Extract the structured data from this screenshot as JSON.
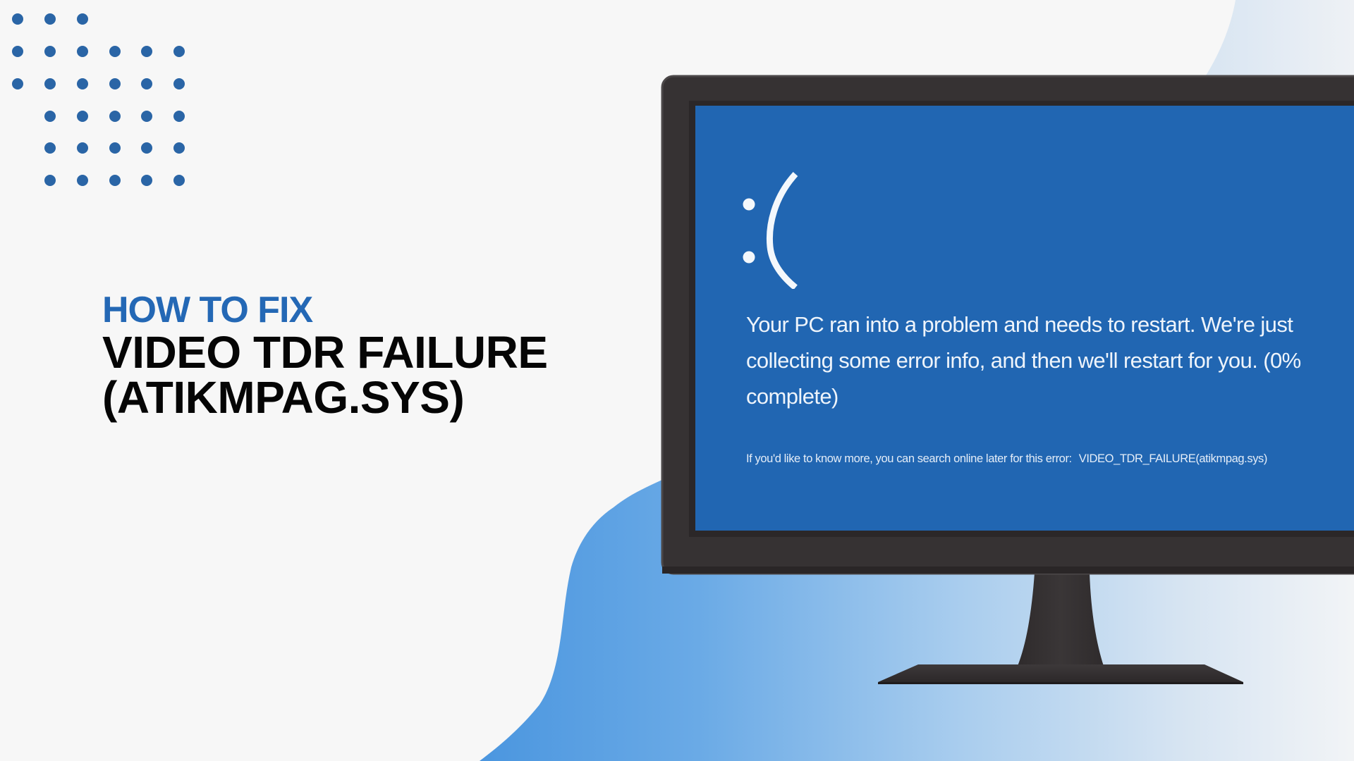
{
  "colors": {
    "background": "#f7f7f7",
    "accent_blue": "#2468b5",
    "dot_blue": "#2a65a6",
    "blob_blue_start": "#4b96df",
    "blob_blue_end": "#e8eef6",
    "screen_blue": "#2166b2",
    "bezel": "#363233",
    "headline": "#050505"
  },
  "decor": {
    "dot_grid_icon": "dot-grid",
    "dot_rows": [
      [
        1,
        1,
        1,
        0,
        0,
        0
      ],
      [
        1,
        1,
        1,
        1,
        1,
        1
      ],
      [
        1,
        1,
        1,
        1,
        1,
        1
      ],
      [
        0,
        1,
        1,
        1,
        1,
        1
      ],
      [
        0,
        1,
        1,
        1,
        1,
        1
      ],
      [
        0,
        1,
        1,
        1,
        1,
        1
      ]
    ]
  },
  "title": {
    "kicker": "HOW TO FIX",
    "line1": "VIDEO TDR FAILURE",
    "line2": "(ATIKMPAG.SYS)"
  },
  "bsod": {
    "face": ":(",
    "message_lines": [
      "Your PC ran into a problem and needs to restart. We're just",
      "collecting some error info, and then we'll restart for you. (0%",
      "complete)"
    ],
    "progress_percent": 0,
    "more_info": "If you'd like to know more, you can search online later for this error:",
    "stop_code": "VIDEO_TDR_FAILURE(atikmpag.sys)"
  }
}
